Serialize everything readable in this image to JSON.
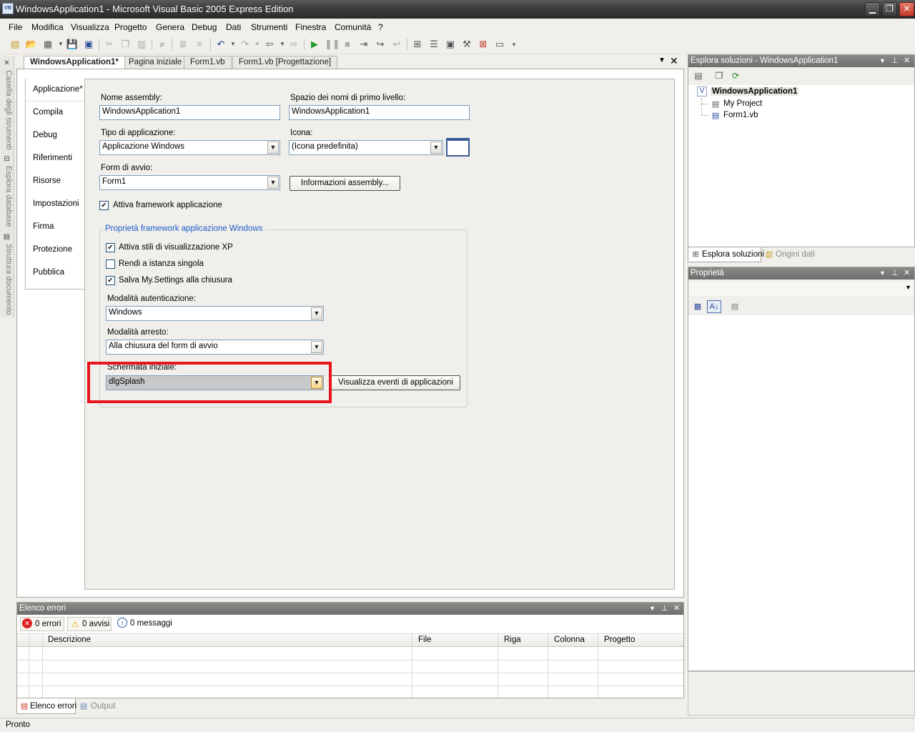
{
  "window": {
    "title": "WindowsApplication1 - Microsoft Visual Basic 2005 Express Edition",
    "icon": "VB"
  },
  "menu": [
    "File",
    "Modifica",
    "Visualizza",
    "Progetto",
    "Genera",
    "Debug",
    "Dati",
    "Strumenti",
    "Finestra",
    "Comunità",
    "?"
  ],
  "side_tabs": [
    "Casella degli strumenti",
    "Esplora database",
    "Struttura documento"
  ],
  "doc_tabs": [
    "WindowsApplication1*",
    "Pagina iniziale",
    "Form1.vb",
    "Form1.vb [Progettazione]"
  ],
  "left_nav": [
    "Applicazione*",
    "Compila",
    "Debug",
    "Riferimenti",
    "Risorse",
    "Impostazioni",
    "Firma",
    "Protezione",
    "Pubblica"
  ],
  "form": {
    "assembly_label": "Nome assembly:",
    "assembly_value": "WindowsApplication1",
    "namespace_label": "Spazio dei nomi di primo livello:",
    "namespace_value": "WindowsApplication1",
    "apptype_label": "Tipo di applicazione:",
    "apptype_value": "Applicazione Windows",
    "icon_label": "Icona:",
    "icon_value": "(Icona predefinita)",
    "startup_label": "Form di avvio:",
    "startup_value": "Form1",
    "assembly_info_button": "Informazioni assembly...",
    "enable_framework": "Attiva framework applicazione",
    "group_title": "Proprietà framework applicazione Windows",
    "xp_styles": "Attiva stili di visualizzazione XP",
    "single_instance": "Rendi a istanza singola",
    "save_settings": "Salva My.Settings alla chiusura",
    "auth_label": "Modalità autenticazione:",
    "auth_value": "Windows",
    "shutdown_label": "Modalità arresto:",
    "shutdown_value": "Alla chiusura del form di avvio",
    "splash_label": "Schermata iniziale:",
    "splash_value": "dlgSplash",
    "view_events_button": "Visualizza eventi di applicazioni"
  },
  "error_list": {
    "title": "Elenco errori",
    "errors": "0 errori",
    "warnings": "0 avvisi",
    "messages": "0 messaggi",
    "columns": [
      "Descrizione",
      "File",
      "Riga",
      "Colonna",
      "Progetto"
    ],
    "bottom_tabs": [
      "Elenco errori",
      "Output"
    ]
  },
  "solution": {
    "title": "Esplora soluzioni - WindowsApplication1",
    "root": "WindowsApplication1",
    "items": [
      "My Project",
      "Form1.vb"
    ],
    "tabs": [
      "Esplora soluzioni",
      "Origini dati"
    ]
  },
  "properties": {
    "title": "Proprietà"
  },
  "status": "Pronto"
}
